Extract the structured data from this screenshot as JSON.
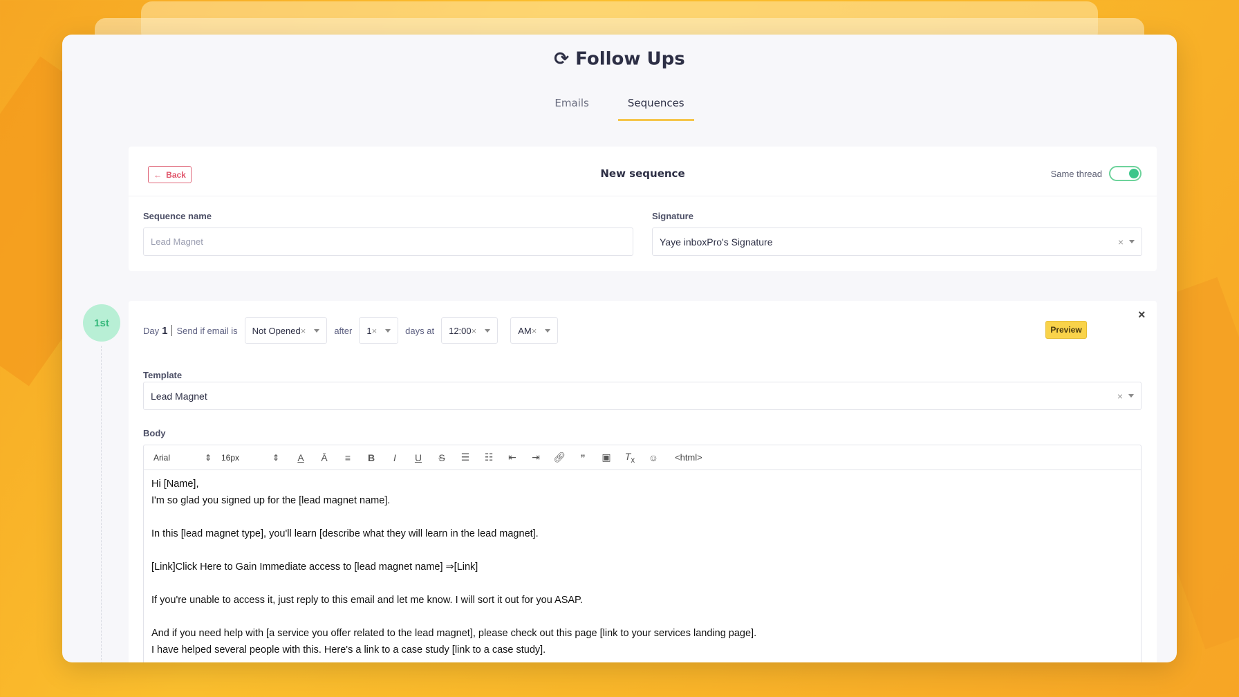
{
  "title": "Follow Ups",
  "tabs": [
    {
      "label": "Emails"
    },
    {
      "label": "Sequences"
    }
  ],
  "header": {
    "back": "Back",
    "title": "New sequence",
    "same_thread": "Same thread",
    "same_thread_on": true
  },
  "sequence_name": {
    "label": "Sequence name",
    "placeholder": "Lead Magnet"
  },
  "signature": {
    "label": "Signature",
    "value": "Yaye inboxPro's Signature"
  },
  "step": {
    "badge": "1st",
    "day_label": "Day",
    "day": "1",
    "send_if": "Send if email is",
    "condition": "Not Opened",
    "after": "after",
    "after_value": "1",
    "days_at": "days at",
    "time": "12:00",
    "ampm": "AM",
    "preview": "Preview",
    "remove": "×"
  },
  "template": {
    "label": "Template",
    "value": "Lead Magnet"
  },
  "body": {
    "label": "Body",
    "font": "Arial",
    "size": "16px",
    "html": "<html>",
    "lines": [
      "Hi [Name],",
      "I'm so glad you signed up for the [lead magnet name].",
      "",
      "In this [lead magnet type], you'll learn [describe what they will learn in the lead magnet].",
      "",
      "[Link]Click Here to Gain Immediate access to [lead magnet name] ⇒[Link]",
      "",
      "If you're unable to access it, just reply to this email and let me know. I will sort it out for you ASAP.",
      "",
      "And if you need help with [a service you offer related to the lead magnet], please check out this page [link to your services landing page].",
      "I have helped several people with this. Here's a link to a case study [link to a case study]."
    ]
  }
}
